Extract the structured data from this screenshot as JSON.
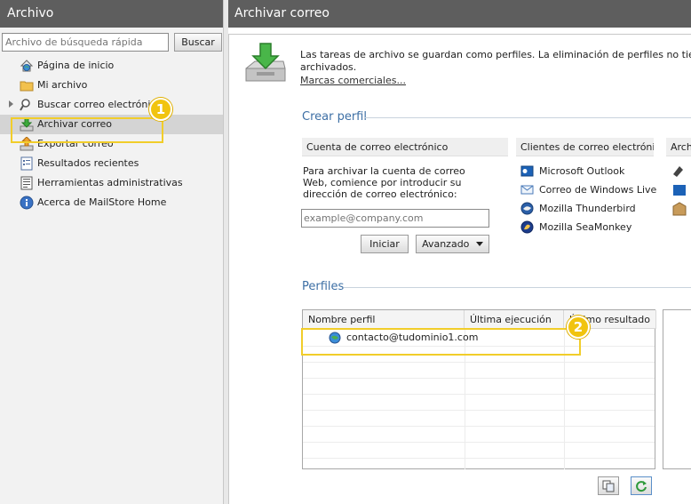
{
  "left": {
    "title": "Archivo",
    "search_placeholder": "Archivo de búsqueda rápida",
    "search_button": "Buscar",
    "nav": [
      {
        "label": "Página de inicio",
        "icon": "home-globe-icon"
      },
      {
        "label": "Mi archivo",
        "icon": "folder-icon"
      },
      {
        "label": "Buscar correo electrónico",
        "icon": "magnifier-icon"
      },
      {
        "label": "Archivar correo",
        "icon": "archive-download-icon"
      },
      {
        "label": "Exportar correo",
        "icon": "export-icon"
      },
      {
        "label": "Resultados recientes",
        "icon": "recent-results-icon"
      },
      {
        "label": "Herramientas administrativas",
        "icon": "admin-tools-icon"
      },
      {
        "label": "Acerca de MailStore Home",
        "icon": "info-icon"
      }
    ],
    "badge": "1"
  },
  "right": {
    "title": "Archivar correo",
    "intro_text_line1": "Las tareas de archivo se guardan como perfiles. La eliminación de perfiles no tiene efecto en",
    "intro_text_line2": "archivados.",
    "trademarks_link": "Marcas comerciales...",
    "create_profile_title": "Crear perfil",
    "col_email_account": "Cuenta de correo electrónico",
    "col_email_clients": "Clientes de correo electrónico",
    "col_archive": "Arch",
    "explain_text": "Para archivar la cuenta de correo Web, comience por introducir su dirección de correo electrónico:",
    "email_placeholder": "example@company.com",
    "start_button": "Iniciar",
    "advanced_button": "Avanzado",
    "clients": [
      {
        "label": "Microsoft Outlook",
        "icon": "outlook-icon"
      },
      {
        "label": "Correo de Windows Live",
        "icon": "windows-live-mail-icon"
      },
      {
        "label": "Mozilla Thunderbird",
        "icon": "thunderbird-icon"
      },
      {
        "label": "Mozilla SeaMonkey",
        "icon": "seamonkey-icon"
      }
    ],
    "profiles_title": "Perfiles",
    "table": {
      "headers": [
        "Nombre perfil",
        "Última ejecución",
        "Último resultado"
      ],
      "rows": [
        {
          "name": "contacto@tudominio1.com",
          "last_run": "",
          "last_result": ""
        }
      ]
    },
    "badge": "2",
    "accent_color": "#3d6fa5",
    "highlight_color": "#f1cd2a"
  }
}
